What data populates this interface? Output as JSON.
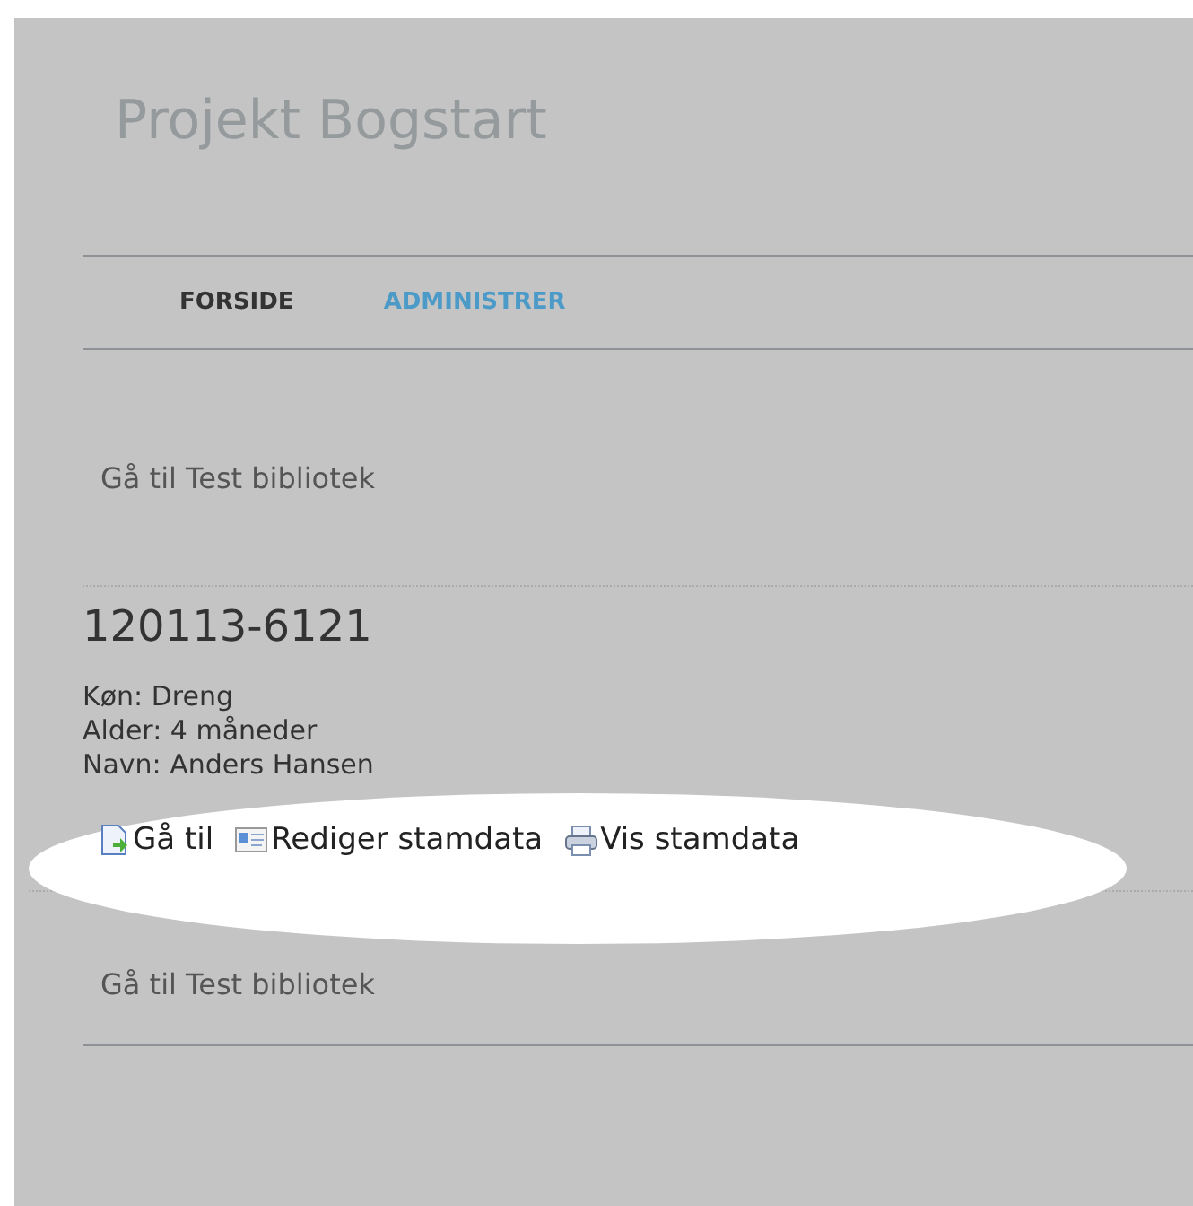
{
  "title": "Projekt Bogstart",
  "nav": [
    {
      "label": "FORSIDE",
      "selected": true
    },
    {
      "label": "ADMINISTRER",
      "selected": false
    }
  ],
  "top_link": "Gå til Test bibliotek",
  "record": {
    "id": "120113-6121",
    "details": [
      "Køn: Dreng",
      "Alder: 4 måneder",
      "Navn: Anders Hansen"
    ],
    "actions": [
      {
        "kind": "goto",
        "label": "Gå til"
      },
      {
        "kind": "edit",
        "label": "Rediger stamdata"
      },
      {
        "kind": "print",
        "label": "Vis stamdata"
      }
    ],
    "highlighted": true
  },
  "bottom_link": "Gå til Test bibliotek"
}
